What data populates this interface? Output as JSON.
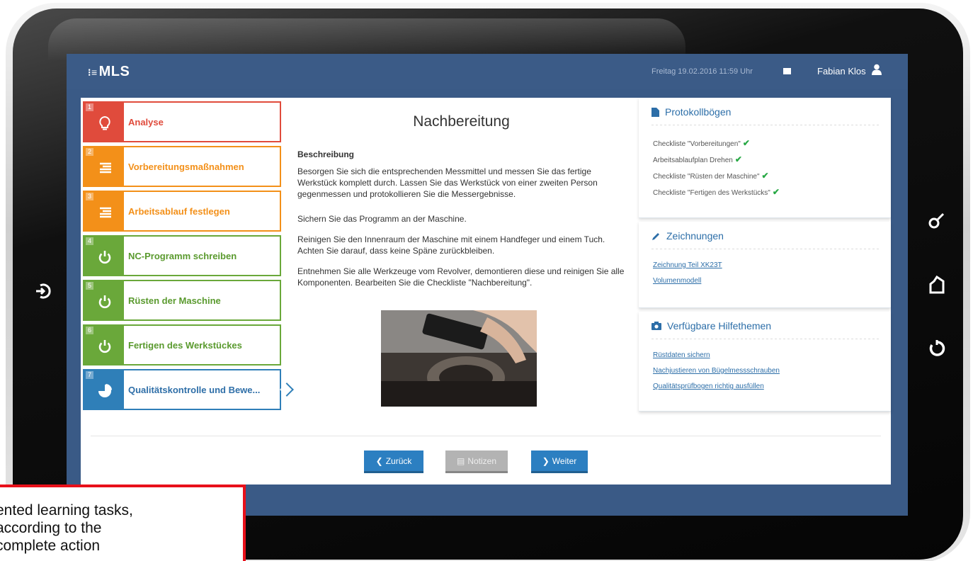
{
  "app": {
    "logo": "MLS",
    "datetime": "Freitag 19.02.2016 11:59 Uhr",
    "user_name": "Fabian Klos"
  },
  "steps": [
    {
      "num": "1",
      "label": "Analyse",
      "color": "#e04b3c",
      "icon": "lightbulb-icon",
      "state": "done"
    },
    {
      "num": "2",
      "label": "Vorbereitungsmaßnahmen",
      "color": "#f39019",
      "icon": "list-icon",
      "state": "done"
    },
    {
      "num": "3",
      "label": "Arbeitsablauf festlegen",
      "color": "#f39019",
      "icon": "list-icon",
      "state": "done"
    },
    {
      "num": "4",
      "label": "NC-Programm schreiben",
      "color": "#6aa83a",
      "icon": "power-icon",
      "state": "done"
    },
    {
      "num": "5",
      "label": "Rüsten der Maschine",
      "color": "#6aa83a",
      "icon": "power-icon",
      "state": "done"
    },
    {
      "num": "6",
      "label": "Fertigen des Werkstückes",
      "color": "#6aa83a",
      "icon": "power-icon",
      "state": "done"
    },
    {
      "num": "7",
      "label": "Qualitätskontrolle und Bewe...",
      "color": "#2f7fb8",
      "icon": "pie-chart-icon",
      "state": "active"
    }
  ],
  "content": {
    "title": "Nachbereitung",
    "description_heading": "Beschreibung",
    "paragraphs": [
      "Besorgen Sie sich die entsprechenden Messmittel und messen Sie das fertige Werkstück komplett durch. Lassen Sie das Werkstück von einer zweiten Person gegenmessen und protokollieren Sie die Messergebnisse.",
      "Sichern Sie das Programm an der Maschine.",
      "Reinigen Sie den Innenraum der Maschine mit einem Handfeger und einem Tuch. Achten Sie darauf, dass keine Späne zurückbleiben.",
      "Entnehmen Sie alle Werkzeuge vom Revolver, demontieren diese und reinigen Sie alle Komponenten. Bearbeiten Sie die Checkliste \"Nachbereitung\"."
    ]
  },
  "buttons": {
    "back": "Zurück",
    "notes": "Notizen",
    "next": "Weiter"
  },
  "protocols": {
    "title": "Protokollbögen",
    "items": [
      "Checkliste \"Vorbereitungen\"",
      "Arbeitsablaufplan Drehen",
      "Checkliste \"Rüsten der Maschine\"",
      "Checkliste \"Fertigen des Werkstücks\""
    ]
  },
  "drawings": {
    "title": "Zeichnungen",
    "links": [
      "Zeichnung Teil XK23T",
      "Volumenmodell"
    ]
  },
  "help": {
    "title": "Verfügbare Hilfethemen",
    "links": [
      "Rüstdaten sichern",
      "Nachjustieren von Bügelmessschrauben",
      "Qualitätsprüfbogen richtig ausfüllen"
    ]
  },
  "callout": {
    "lines": [
      "ented learning tasks,",
      "according to the",
      "complete action"
    ]
  },
  "colors": {
    "header_bg": "#3b5b87",
    "accent_blue": "#2c7fc1",
    "check_green": "#27a844",
    "callout_border": "#e8101a"
  }
}
